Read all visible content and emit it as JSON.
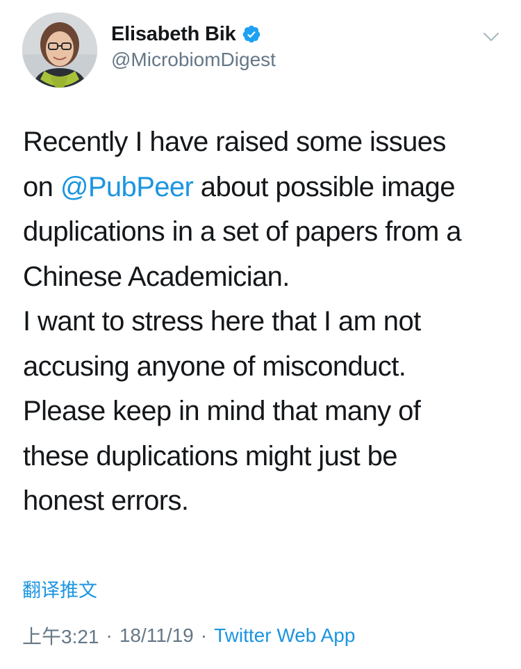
{
  "user": {
    "display_name": "Elisabeth Bik",
    "handle": "@MicrobiomDigest",
    "verified": true
  },
  "tweet": {
    "lines": [
      {
        "before": "Recently I have raised some issues",
        "mention": "",
        "after": ""
      },
      {
        "before": "on ",
        "mention": "@PubPeer",
        "after": " about possible image"
      },
      {
        "before": "duplications in a set of papers from a",
        "mention": "",
        "after": ""
      },
      {
        "before": "Chinese Academician.",
        "mention": "",
        "after": ""
      },
      {
        "before": "I want to stress here that I am not",
        "mention": "",
        "after": ""
      },
      {
        "before": "accusing anyone of misconduct.",
        "mention": "",
        "after": ""
      },
      {
        "before": "Please keep in mind that many of",
        "mention": "",
        "after": ""
      },
      {
        "before": "these duplications might just be",
        "mention": "",
        "after": ""
      },
      {
        "before": "honest errors.",
        "mention": "",
        "after": ""
      }
    ]
  },
  "translate_label": "翻译推文",
  "meta": {
    "time": "上午3:21",
    "separator": "·",
    "date": "18/11/19",
    "source": "Twitter Web App"
  },
  "colors": {
    "link": "#1b95e0",
    "secondary": "#657786",
    "text": "#14171a"
  },
  "icons": {
    "verified": "verified-badge-icon",
    "menu": "chevron-down-icon"
  }
}
